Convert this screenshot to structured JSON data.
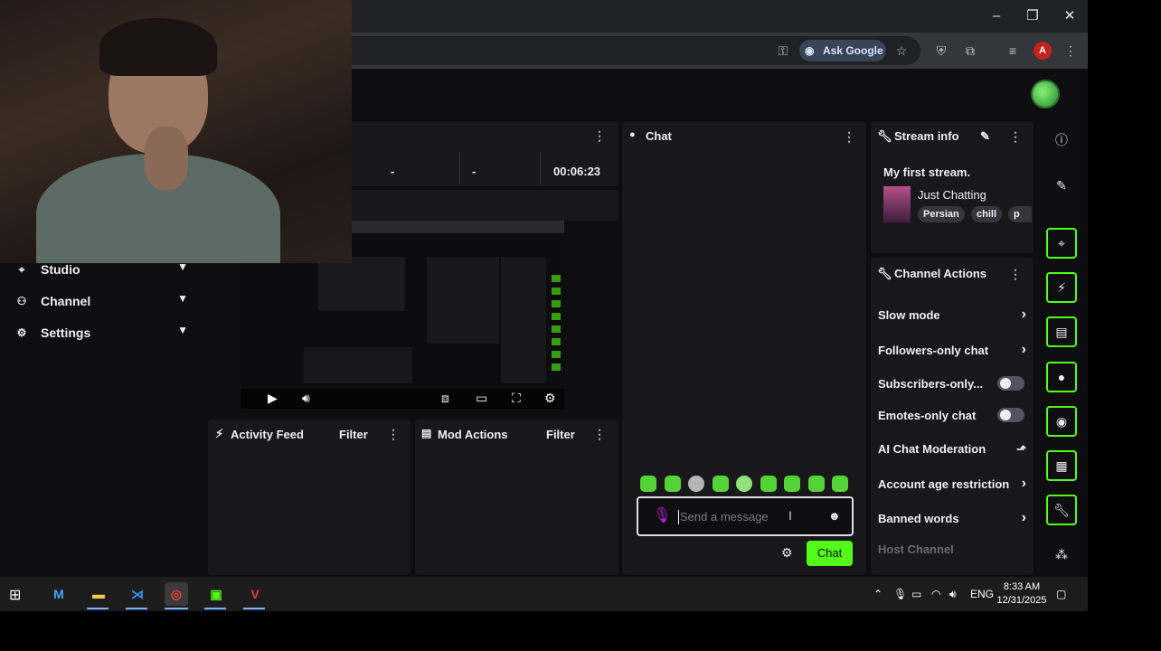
{
  "browser": {
    "ask_google_label": "Ask Google",
    "profile_initial": "A"
  },
  "window_controls": {
    "minimize": "–",
    "maximize": "❐",
    "close": "✕"
  },
  "sidebar": {
    "items": [
      {
        "label": "Studio",
        "icon": "studio-icon"
      },
      {
        "label": "Channel",
        "icon": "channel-icon"
      },
      {
        "label": "Settings",
        "icon": "gear-icon"
      }
    ]
  },
  "stream_stats": {
    "values": [
      "-",
      "-"
    ],
    "uptime": "00:06:23"
  },
  "activity_feed": {
    "title": "Activity Feed",
    "filter_label": "Filter"
  },
  "mod_actions": {
    "title": "Mod Actions",
    "filter_label": "Filter"
  },
  "chat": {
    "title": "Chat",
    "input_placeholder": "Send a message",
    "send_label": "Chat"
  },
  "stream_info": {
    "title": "Stream info",
    "stream_title": "My first stream.",
    "category": "Just Chatting",
    "tags": [
      "Persian",
      "chill",
      "p"
    ]
  },
  "channel_actions": {
    "title": "Channel Actions",
    "items": [
      {
        "label": "Slow mode",
        "control": "arrow"
      },
      {
        "label": "Followers-only chat",
        "control": "arrow"
      },
      {
        "label": "Subscribers-only...",
        "control": "toggle",
        "on": false
      },
      {
        "label": "Emotes-only chat",
        "control": "toggle",
        "on": false
      },
      {
        "label": "AI Chat Moderation",
        "control": "chart"
      },
      {
        "label": "Account age restriction",
        "control": "arrow"
      },
      {
        "label": "Banned words",
        "control": "arrow"
      }
    ],
    "disabled_item": "Host Channel"
  },
  "taskbar": {
    "time": "8:33 AM",
    "date": "12/31/2025",
    "language": "ENG"
  },
  "colors": {
    "accent": "#53fc18",
    "panel": "#18181b",
    "background": "#0e0e10"
  }
}
